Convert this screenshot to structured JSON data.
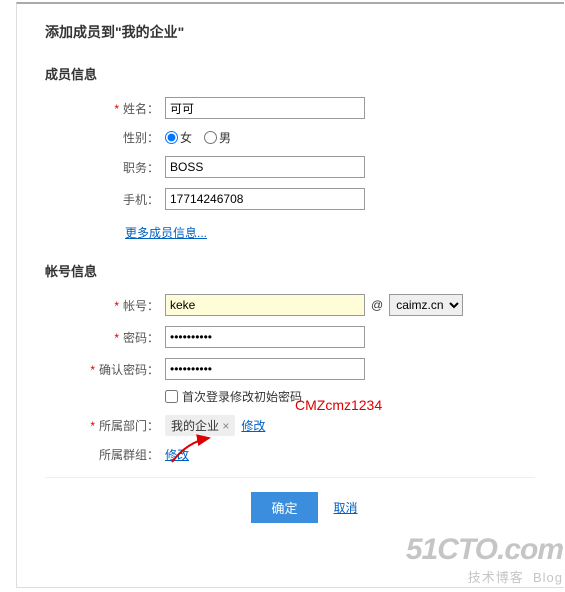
{
  "page_title": "添加成员到\"我的企业\"",
  "sections": {
    "member": {
      "title": "成员信息",
      "name": {
        "label": "姓名：",
        "value": "可可"
      },
      "gender": {
        "label": "性别：",
        "female": "女",
        "male": "男",
        "selected": "female"
      },
      "position": {
        "label": "职务：",
        "value": "BOSS"
      },
      "phone": {
        "label": "手机：",
        "value": "17714246708"
      },
      "more_link": "更多成员信息..."
    },
    "account": {
      "title": "帐号信息",
      "account_field": {
        "label": "帐号：",
        "value": "keke"
      },
      "at": "@",
      "domain": "caimz.cn",
      "password": {
        "label": "密码：",
        "value": "••••••••••"
      },
      "confirm": {
        "label": "确认密码：",
        "value": "••••••••••"
      },
      "first_login": "首次登录修改初始密码",
      "dept": {
        "label": "所属部门：",
        "value": "我的企业",
        "modify": "修改"
      },
      "group": {
        "label": "所属群组：",
        "modify": "修改"
      }
    }
  },
  "annotation": "CMZcmz1234",
  "buttons": {
    "submit": "确定",
    "cancel": "取消"
  },
  "watermark": {
    "brand": "51CTO.com",
    "tag": "技术博客",
    "blog": "Blog"
  }
}
